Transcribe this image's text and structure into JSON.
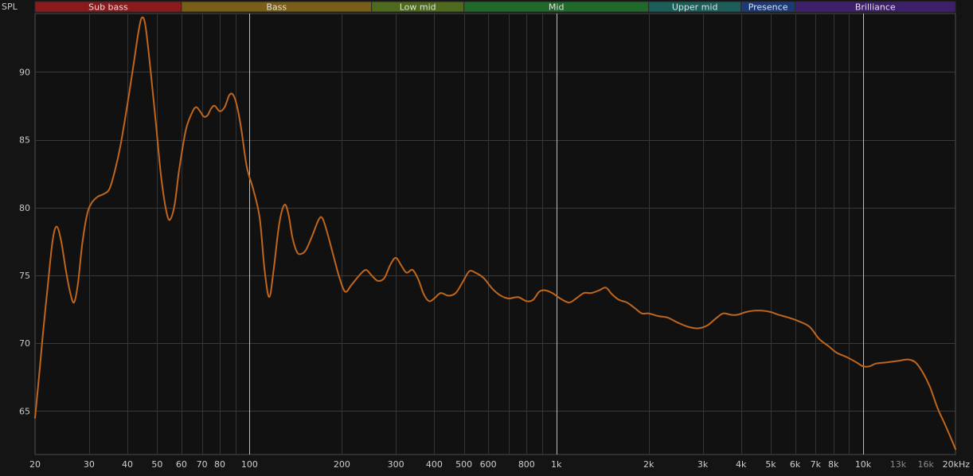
{
  "chart_data": {
    "type": "line",
    "y_axis_label": "SPL",
    "x_unit_label": "Hz",
    "x_scale": "log",
    "xlim": [
      20,
      20000
    ],
    "ylim": [
      61.8,
      94.3
    ],
    "grid": true,
    "bands": [
      {
        "name": "Sub bass",
        "range": [
          20,
          60
        ],
        "color": "#8a1a1c"
      },
      {
        "name": "Bass",
        "range": [
          60,
          250
        ],
        "color": "#7a5e17"
      },
      {
        "name": "Low mid",
        "range": [
          250,
          500
        ],
        "color": "#4d6a1d"
      },
      {
        "name": "Mid",
        "range": [
          500,
          2000
        ],
        "color": "#1f6a2a"
      },
      {
        "name": "Upper mid",
        "range": [
          2000,
          4000
        ],
        "color": "#1b5e5a"
      },
      {
        "name": "Presence",
        "range": [
          4000,
          6000
        ],
        "color": "#1d3a78"
      },
      {
        "name": "Brilliance",
        "range": [
          6000,
          20000
        ],
        "color": "#3e1f6b"
      }
    ],
    "y_ticks": [
      {
        "value": 65,
        "label": "65"
      },
      {
        "value": 70,
        "label": "70"
      },
      {
        "value": 75,
        "label": "75"
      },
      {
        "value": 80,
        "label": "80"
      },
      {
        "value": 85,
        "label": "85"
      },
      {
        "value": 90,
        "label": "90"
      }
    ],
    "x_ticks": [
      {
        "value": 20,
        "label": "20",
        "dim": false
      },
      {
        "value": 30,
        "label": "30",
        "dim": false
      },
      {
        "value": 40,
        "label": "40",
        "dim": false
      },
      {
        "value": 50,
        "label": "50",
        "dim": false
      },
      {
        "value": 60,
        "label": "60",
        "dim": false
      },
      {
        "value": 70,
        "label": "70",
        "dim": false
      },
      {
        "value": 80,
        "label": "80",
        "dim": false
      },
      {
        "value": 100,
        "label": "100",
        "dim": false
      },
      {
        "value": 200,
        "label": "200",
        "dim": false
      },
      {
        "value": 300,
        "label": "300",
        "dim": false
      },
      {
        "value": 400,
        "label": "400",
        "dim": false
      },
      {
        "value": 500,
        "label": "500",
        "dim": false
      },
      {
        "value": 600,
        "label": "600",
        "dim": false
      },
      {
        "value": 800,
        "label": "800",
        "dim": false
      },
      {
        "value": 1000,
        "label": "1k",
        "dim": false
      },
      {
        "value": 2000,
        "label": "2k",
        "dim": false
      },
      {
        "value": 3000,
        "label": "3k",
        "dim": false
      },
      {
        "value": 4000,
        "label": "4k",
        "dim": false
      },
      {
        "value": 5000,
        "label": "5k",
        "dim": false
      },
      {
        "value": 6000,
        "label": "6k",
        "dim": false
      },
      {
        "value": 7000,
        "label": "7k",
        "dim": false
      },
      {
        "value": 8000,
        "label": "8k",
        "dim": false
      },
      {
        "value": 10000,
        "label": "10k",
        "dim": false
      },
      {
        "value": 13000,
        "label": "13k",
        "dim": true
      },
      {
        "value": 16000,
        "label": "16k",
        "dim": true
      },
      {
        "value": 20000,
        "label": "20kHz",
        "dim": false
      }
    ],
    "decade_lines": [
      100,
      1000,
      10000
    ],
    "series": [
      {
        "color": "#c0661c",
        "points": [
          [
            20,
            64.5
          ],
          [
            20.6,
            67.5
          ],
          [
            21.2,
            70.6
          ],
          [
            22,
            74.2
          ],
          [
            22.8,
            77.5
          ],
          [
            23.5,
            78.6
          ],
          [
            24.3,
            77.6
          ],
          [
            25.2,
            75.4
          ],
          [
            26,
            73.8
          ],
          [
            26.8,
            73.0
          ],
          [
            27.6,
            74.4
          ],
          [
            28.5,
            77.3
          ],
          [
            29.5,
            79.4
          ],
          [
            30.5,
            80.3
          ],
          [
            32,
            80.8
          ],
          [
            33.5,
            81.0
          ],
          [
            35,
            81.4
          ],
          [
            36.5,
            82.8
          ],
          [
            38,
            84.6
          ],
          [
            40,
            87.6
          ],
          [
            42,
            90.7
          ],
          [
            43.5,
            93.0
          ],
          [
            44.6,
            94.0
          ],
          [
            45.8,
            93.4
          ],
          [
            47.5,
            90.3
          ],
          [
            49.5,
            86.3
          ],
          [
            51.5,
            82.3
          ],
          [
            53.5,
            79.8
          ],
          [
            55,
            79.1
          ],
          [
            57,
            80.2
          ],
          [
            59,
            82.8
          ],
          [
            62,
            85.7
          ],
          [
            65,
            87.0
          ],
          [
            67,
            87.4
          ],
          [
            69,
            87.1
          ],
          [
            71,
            86.7
          ],
          [
            73,
            86.8
          ],
          [
            75,
            87.3
          ],
          [
            77,
            87.5
          ],
          [
            80,
            87.1
          ],
          [
            83,
            87.4
          ],
          [
            86,
            88.3
          ],
          [
            88.5,
            88.3
          ],
          [
            91,
            87.5
          ],
          [
            94,
            85.8
          ],
          [
            98,
            83.0
          ],
          [
            103,
            81.3
          ],
          [
            108,
            79.2
          ],
          [
            112,
            75.4
          ],
          [
            116,
            73.4
          ],
          [
            120,
            75.5
          ],
          [
            125,
            78.8
          ],
          [
            130,
            80.2
          ],
          [
            134,
            79.5
          ],
          [
            138,
            77.8
          ],
          [
            143,
            76.7
          ],
          [
            148,
            76.6
          ],
          [
            153,
            76.9
          ],
          [
            160,
            77.9
          ],
          [
            168,
            79.1
          ],
          [
            173,
            79.2
          ],
          [
            180,
            78.0
          ],
          [
            188,
            76.4
          ],
          [
            196,
            74.9
          ],
          [
            205,
            73.8
          ],
          [
            215,
            74.3
          ],
          [
            230,
            75.1
          ],
          [
            240,
            75.4
          ],
          [
            250,
            75.0
          ],
          [
            262,
            74.6
          ],
          [
            275,
            74.8
          ],
          [
            288,
            75.8
          ],
          [
            300,
            76.3
          ],
          [
            313,
            75.7
          ],
          [
            325,
            75.2
          ],
          [
            340,
            75.4
          ],
          [
            355,
            74.7
          ],
          [
            370,
            73.6
          ],
          [
            385,
            73.1
          ],
          [
            400,
            73.3
          ],
          [
            420,
            73.7
          ],
          [
            445,
            73.5
          ],
          [
            470,
            73.7
          ],
          [
            495,
            74.5
          ],
          [
            520,
            75.3
          ],
          [
            545,
            75.2
          ],
          [
            580,
            74.8
          ],
          [
            620,
            74.0
          ],
          [
            660,
            73.5
          ],
          [
            700,
            73.3
          ],
          [
            750,
            73.4
          ],
          [
            800,
            73.1
          ],
          [
            840,
            73.2
          ],
          [
            880,
            73.8
          ],
          [
            920,
            73.9
          ],
          [
            970,
            73.7
          ],
          [
            1030,
            73.3
          ],
          [
            1100,
            73.0
          ],
          [
            1160,
            73.3
          ],
          [
            1230,
            73.7
          ],
          [
            1300,
            73.7
          ],
          [
            1380,
            73.9
          ],
          [
            1450,
            74.1
          ],
          [
            1520,
            73.6
          ],
          [
            1600,
            73.2
          ],
          [
            1700,
            73.0
          ],
          [
            1800,
            72.6
          ],
          [
            1900,
            72.2
          ],
          [
            2000,
            72.2
          ],
          [
            2150,
            72.0
          ],
          [
            2300,
            71.9
          ],
          [
            2500,
            71.5
          ],
          [
            2700,
            71.2
          ],
          [
            2900,
            71.1
          ],
          [
            3100,
            71.3
          ],
          [
            3300,
            71.8
          ],
          [
            3500,
            72.2
          ],
          [
            3700,
            72.1
          ],
          [
            3900,
            72.1
          ],
          [
            4150,
            72.3
          ],
          [
            4400,
            72.4
          ],
          [
            4700,
            72.4
          ],
          [
            5000,
            72.3
          ],
          [
            5300,
            72.1
          ],
          [
            5700,
            71.9
          ],
          [
            6200,
            71.6
          ],
          [
            6700,
            71.2
          ],
          [
            7200,
            70.3
          ],
          [
            7700,
            69.8
          ],
          [
            8200,
            69.3
          ],
          [
            8800,
            69.0
          ],
          [
            9500,
            68.6
          ],
          [
            10000,
            68.3
          ],
          [
            10500,
            68.3
          ],
          [
            11000,
            68.5
          ],
          [
            12000,
            68.6
          ],
          [
            13000,
            68.7
          ],
          [
            14000,
            68.8
          ],
          [
            14800,
            68.6
          ],
          [
            15600,
            67.9
          ],
          [
            16500,
            66.8
          ],
          [
            17500,
            65.2
          ],
          [
            18500,
            64.0
          ],
          [
            19500,
            62.8
          ],
          [
            20000,
            62.2
          ]
        ]
      }
    ]
  }
}
